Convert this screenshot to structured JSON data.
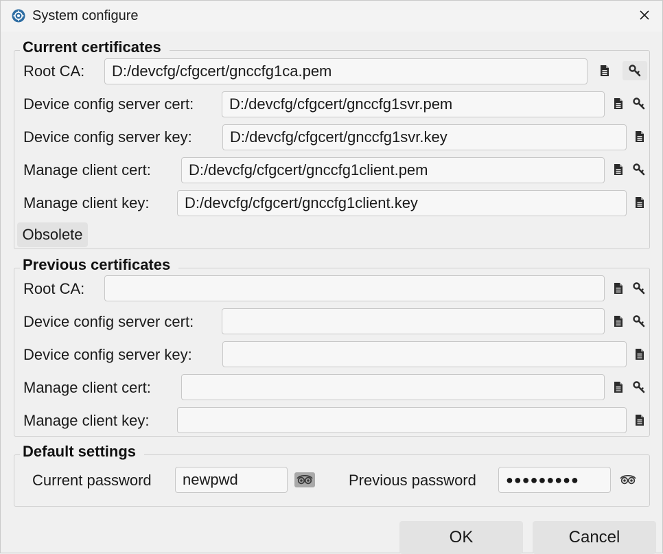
{
  "window": {
    "title": "System configure"
  },
  "current_group": {
    "legend": "Current certificates",
    "rows": [
      {
        "label": "Root CA:",
        "value": "D:/devcfg/cfgcert/gnccfg1ca.pem"
      },
      {
        "label": "Device config server cert:",
        "value": "D:/devcfg/cfgcert/gnccfg1svr.pem"
      },
      {
        "label": "Device config server key:",
        "value": "D:/devcfg/cfgcert/gnccfg1svr.key"
      },
      {
        "label": "Manage client cert:",
        "value": "D:/devcfg/cfgcert/gnccfg1client.pem"
      },
      {
        "label": "Manage client key:",
        "value": "D:/devcfg/cfgcert/gnccfg1client.key"
      }
    ],
    "obsolete_label": "Obsolete"
  },
  "previous_group": {
    "legend": "Previous certificates",
    "rows": [
      {
        "label": "Root CA:",
        "value": ""
      },
      {
        "label": "Device config server cert:",
        "value": ""
      },
      {
        "label": "Device config server key:",
        "value": ""
      },
      {
        "label": "Manage client cert:",
        "value": ""
      },
      {
        "label": "Manage client key:",
        "value": ""
      }
    ]
  },
  "default_group": {
    "legend": "Default settings",
    "current_password_label": "Current password",
    "current_password_value": "newpwd",
    "previous_password_label": "Previous password",
    "previous_password_value": "●●●●●●●●●"
  },
  "buttons": {
    "ok": "OK",
    "cancel": "Cancel"
  },
  "icons": {
    "app": "gear-icon",
    "close": "close-icon",
    "file": "document-icon",
    "key": "key-icon",
    "eye": "eye-icon"
  },
  "colors": {
    "background": "#f0f0f0",
    "field": "#f7f7f7",
    "border": "#c8c8c8",
    "button": "#e3e3e3",
    "app_icon": "#2f6ea3"
  }
}
